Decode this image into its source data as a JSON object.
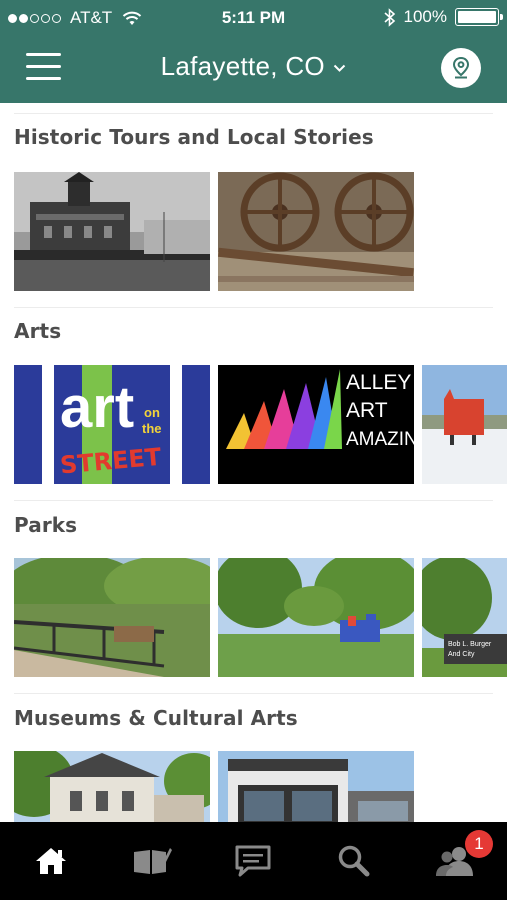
{
  "status_bar": {
    "carrier": "AT&T",
    "time": "5:11 PM",
    "battery": "100%",
    "signal_bars_filled": 2,
    "signal_bars_total": 5
  },
  "nav": {
    "city": "Lafayette, CO",
    "menu_icon": "hamburger-menu-icon",
    "location_icon": "map-pin-icon"
  },
  "sections": [
    {
      "title": "Historic Tours and Local Stories",
      "tiles": [
        "historic-city-hall-photo",
        "old-train-wheels-photo"
      ]
    },
    {
      "title": "Arts",
      "tiles": [
        "art-on-the-street-poster",
        "alley-art-amazin-poster",
        "red-sculpture-in-snow-photo"
      ],
      "art_on_street": {
        "word1": "art",
        "word2": "on",
        "word3": "the",
        "word4": "STREET"
      },
      "alley_art": {
        "line1": "ALLEY",
        "line2": "ART",
        "line3": "AMAZIN'"
      }
    },
    {
      "title": "Parks",
      "tiles": [
        "park-bridge-photo",
        "park-playground-photo",
        "park-sign-photo"
      ],
      "park_sign": {
        "line1": "Bob L. Burger",
        "line2": "And City"
      }
    },
    {
      "title": "Museums & Cultural Arts",
      "tiles": [
        "historic-house-photo",
        "gallery-building-photo"
      ]
    }
  ],
  "tabbar": {
    "tabs": [
      "home-icon",
      "book-icon",
      "chat-icon",
      "search-icon",
      "people-icon"
    ],
    "badge_count": "1"
  },
  "colors": {
    "header_bg": "#37766a",
    "section_title": "#4d4d4d",
    "badge": "#e53935",
    "tabbar_bg": "#000000"
  }
}
